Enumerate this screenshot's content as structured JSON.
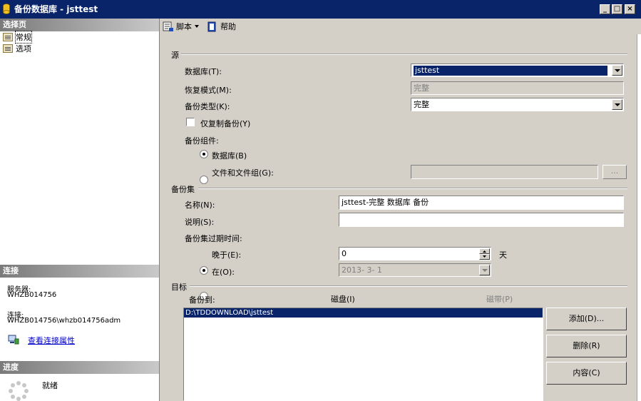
{
  "window": {
    "title": "备份数据库 - jsttest",
    "min_glyph": "_",
    "max_glyph": "□",
    "close_glyph": "×"
  },
  "left": {
    "select_page_header": "选择页",
    "pages": [
      {
        "label": "常规",
        "selected": true
      },
      {
        "label": "选项",
        "selected": false
      }
    ],
    "connection_header": "连接",
    "server_label": "服务器:",
    "server_value": "WHZB014756",
    "connection_label": "连接:",
    "connection_value": "WHZB014756\\whzb014756adm",
    "view_connection_link": "查看连接属性",
    "progress_header": "进度",
    "progress_status": "就绪"
  },
  "toolbar": {
    "script_label": "脚本",
    "help_label": "帮助"
  },
  "source": {
    "group_label": "源",
    "database_label": "数据库(T):",
    "database_value": "jsttest",
    "recovery_label": "恢复模式(M):",
    "recovery_value": "完整",
    "backup_type_label": "备份类型(K):",
    "backup_type_value": "完整",
    "copy_only_label": "仅复制备份(Y)",
    "component_label": "备份组件:",
    "component_db_label": "数据库(B)",
    "component_files_label": "文件和文件组(G):",
    "browse_label": "..."
  },
  "backup_set": {
    "group_label": "备份集",
    "name_label": "名称(N):",
    "name_value": "jsttest-完整 数据库 备份",
    "desc_label": "说明(S):",
    "desc_value": "",
    "expire_label": "备份集过期时间:",
    "after_label": "晚于(E):",
    "after_value": "0",
    "days_unit": "天",
    "on_label": "在(O):",
    "on_value": "2013- 3- 1"
  },
  "destination": {
    "group_label": "目标",
    "backup_to_label": "备份到:",
    "disk_label": "磁盘(I)",
    "tape_label": "磁带(P)",
    "paths": [
      "D:\\TDDOWNLOAD\\jsttest"
    ],
    "add_button": "添加(D)...",
    "remove_button": "删除(R)",
    "contents_button": "内容(C)"
  }
}
